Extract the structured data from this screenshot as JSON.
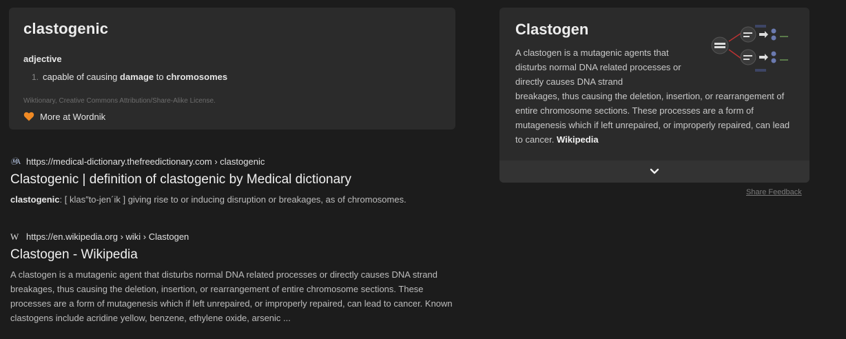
{
  "dictionary": {
    "word": "clastogenic",
    "part_of_speech": "adjective",
    "definition_number": "1.",
    "definition_prefix": "capable of causing ",
    "definition_bold1": "damage",
    "definition_mid": " to ",
    "definition_bold2": "chromosomes",
    "source": "Wiktionary, Creative Commons Attribution/Share-Alike License.",
    "more_link": "More at Wordnik"
  },
  "results": [
    {
      "url": "https://medical-dictionary.thefreedictionary.com › clastogenic",
      "favicon": "thefreedictionary-icon",
      "title": "Clastogenic | definition of clastogenic by Medical dictionary",
      "snippet_bold": "clastogenic",
      "snippet": ": [ klas″to-jen´ik ] giving rise to or inducing disruption or breakages, as of chromosomes."
    },
    {
      "url": "https://en.wikipedia.org › wiki › Clastogen",
      "favicon": "wikipedia-icon",
      "title": "Clastogen - Wikipedia",
      "snippet": "A clastogen is a mutagenic agent that disturbs normal DNA related processes or directly causes DNA strand breakages, thus causing the deletion, insertion, or rearrangement of entire chromosome sections. These processes are a form of mutagenesis which if left unrepaired, or improperly repaired, can lead to cancer. Known clastogens include acridine yellow, benzene, ethylene oxide, arsenic ..."
    }
  ],
  "infobox": {
    "title": "Clastogen",
    "text_narrow": "A clastogen is a mutagenic agents that disturbs normal DNA related processes or directly causes DNA strand",
    "text_wide": "breakages, thus causing the deletion, insertion, or rearrangement of entire chromosome sections. These processes are a form of mutagenesis which if left unrepaired, or improperly repaired, can lead to cancer. ",
    "source": "Wikipedia"
  },
  "feedback_label": "Share Feedback",
  "colors": {
    "background": "#1c1c1c",
    "card": "#2b2b2b",
    "heart": "#f08a24"
  }
}
